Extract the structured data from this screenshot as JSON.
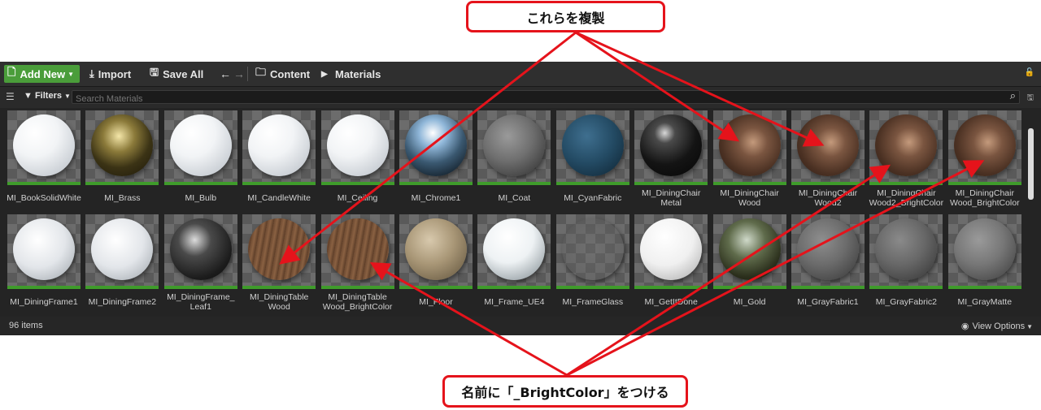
{
  "callouts": {
    "top": "これらを複製",
    "bottom": "名前に「_BrightColor」をつける"
  },
  "toolbar": {
    "add_new": "Add New",
    "import": "Import",
    "save_all": "Save All",
    "breadcrumb": [
      "Content",
      "Materials"
    ]
  },
  "filters": {
    "label": "Filters",
    "search_placeholder": "Search Materials"
  },
  "status": {
    "count": "96 items",
    "view_options": "View Options"
  },
  "colors": {
    "accent_green": "#4a9d3a",
    "callout_red": "#e5131b"
  },
  "assets": [
    {
      "name": "MI_BookSolidWhite",
      "look": "white"
    },
    {
      "name": "MI_Brass",
      "look": "brass"
    },
    {
      "name": "MI_Bulb",
      "look": "white"
    },
    {
      "name": "MI_CandleWhite",
      "look": "white"
    },
    {
      "name": "MI_Ceiling",
      "look": "white"
    },
    {
      "name": "MI_Chrome1",
      "look": "chrome"
    },
    {
      "name": "MI_Coat",
      "look": "fabricgray"
    },
    {
      "name": "MI_CyanFabric",
      "look": "cyan"
    },
    {
      "name": "MI_DiningChair\nMetal",
      "look": "black"
    },
    {
      "name": "MI_DiningChair\nWood",
      "look": "wood"
    },
    {
      "name": "MI_DiningChair\nWood2",
      "look": "wood"
    },
    {
      "name": "MI_DiningChair\nWood2_BrightColor",
      "look": "wood"
    },
    {
      "name": "MI_DiningChair\nWood_BrightColor",
      "look": "wood"
    },
    {
      "name": "MI_DiningFrame1",
      "look": "sketch"
    },
    {
      "name": "MI_DiningFrame2",
      "look": "sketch"
    },
    {
      "name": "MI_DiningFrame_\nLeaf1",
      "look": "leaf"
    },
    {
      "name": "MI_DiningTable\nWood",
      "look": "tablewood"
    },
    {
      "name": "MI_DiningTable\nWood_BrightColor",
      "look": "tablewood"
    },
    {
      "name": "MI_Floor",
      "look": "floor"
    },
    {
      "name": "MI_Frame_UE4",
      "look": "snow"
    },
    {
      "name": "MI_FrameGlass",
      "look": "glass"
    },
    {
      "name": "MI_GetItDone",
      "look": "getitdone"
    },
    {
      "name": "MI_Gold",
      "look": "gold"
    },
    {
      "name": "MI_GrayFabric1",
      "look": "gray1"
    },
    {
      "name": "MI_GrayFabric2",
      "look": "gray2"
    },
    {
      "name": "MI_GrayMatte",
      "look": "gray3"
    }
  ]
}
